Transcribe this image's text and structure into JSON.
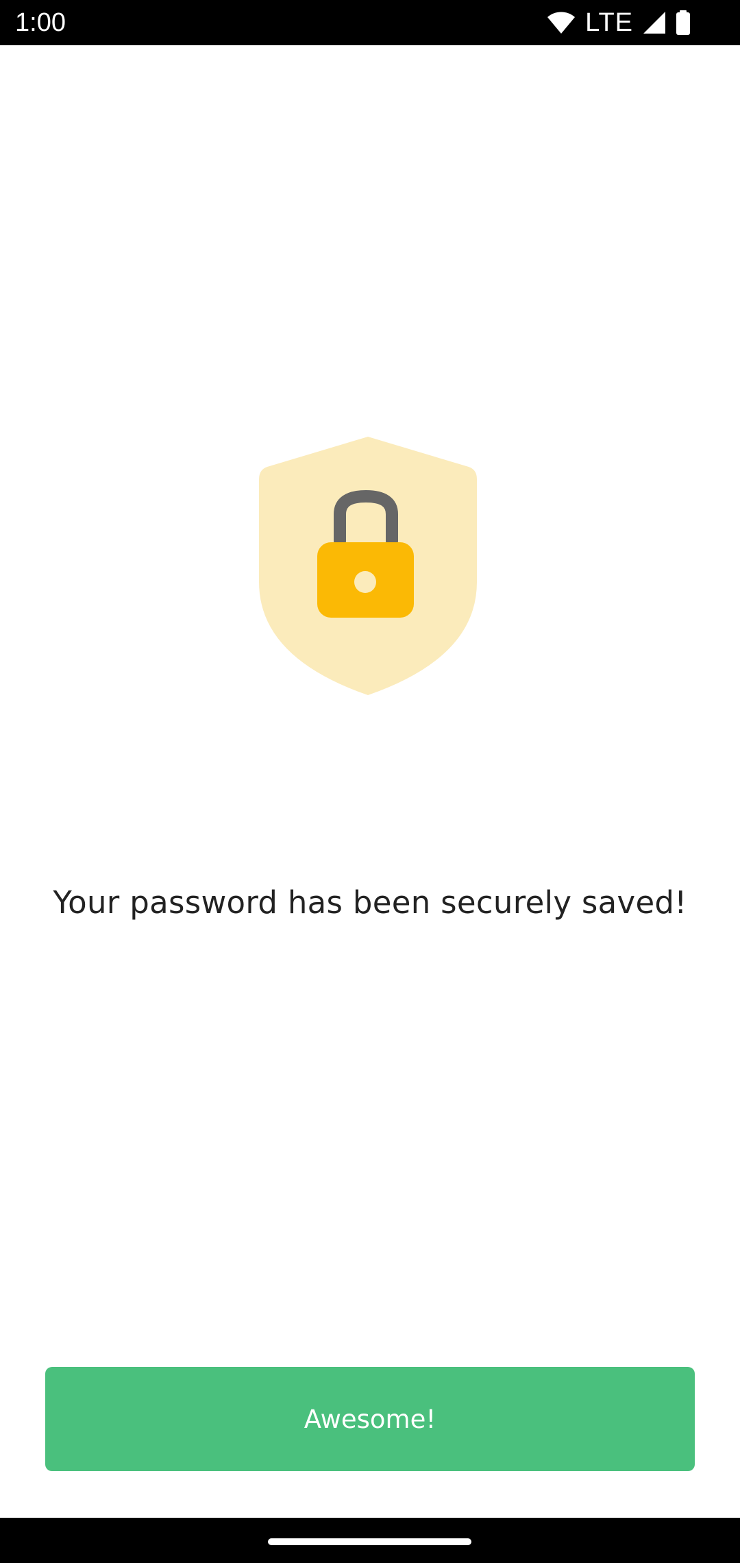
{
  "status_bar": {
    "time": "1:00",
    "network": "LTE",
    "icons": [
      "wifi-icon",
      "cell-signal-icon",
      "battery-icon"
    ]
  },
  "illustration": {
    "icon": "shield-lock-icon",
    "colors": {
      "shield": "#fbebbb",
      "lock_body": "#fbb905",
      "lock_shackle": "#666666",
      "keyhole": "#fbebbb"
    }
  },
  "main": {
    "message": "Your password has been securely saved!"
  },
  "actions": {
    "primary_label": "Awesome!",
    "primary_color": "#4ac07d"
  }
}
